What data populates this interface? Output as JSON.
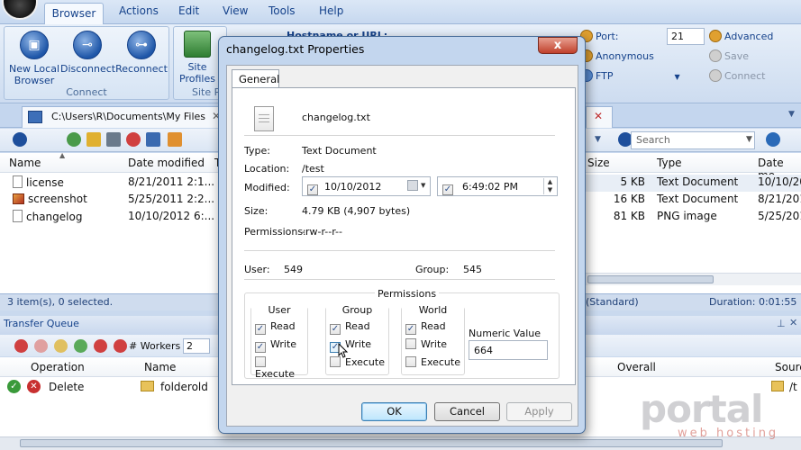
{
  "menu": {
    "items": [
      "Browser",
      "Actions",
      "Edit",
      "View",
      "Tools",
      "Help"
    ]
  },
  "ribbon": {
    "connect_group": {
      "label": "Connect",
      "buttons": [
        "New Local Browser",
        "Disconnect",
        "Reconnect"
      ]
    },
    "site_group": {
      "label": "Site P",
      "button": "Site Profiles"
    },
    "hostname_label": "Hostname or URL:",
    "port_label": "Port:",
    "port_value": "21",
    "advanced_label": "Advanced",
    "anonymous_label": "Anonymous",
    "save_label": "Save",
    "protocol_label": "FTP",
    "connect_label": "Connect"
  },
  "local_tab": {
    "path": "C:\\Users\\R\\Documents\\My Files"
  },
  "toolbar": {
    "search_placeholder": "Search"
  },
  "local_pane": {
    "columns": [
      "Name",
      "Date modified",
      "T"
    ],
    "rows": [
      {
        "name": "license",
        "date": "8/21/2011 2:1..."
      },
      {
        "name": "screenshot",
        "date": "5/25/2011 2:2..."
      },
      {
        "name": "changelog",
        "date": "10/10/2012 6:..."
      }
    ],
    "status": "3 item(s), 0 selected."
  },
  "remote_pane": {
    "columns": [
      "Size",
      "Type",
      "Date mo"
    ],
    "rows": [
      {
        "size": "5 KB",
        "type": "Text Document",
        "date": "10/10/20"
      },
      {
        "size": "16 KB",
        "type": "Text Document",
        "date": "8/21/201"
      },
      {
        "size": "81 KB",
        "type": "PNG image",
        "date": "5/25/201"
      }
    ],
    "status_mode": "(Standard)",
    "status_duration": "Duration: 0:01:55"
  },
  "transfer_queue": {
    "title": "Transfer Queue",
    "workers_label": "# Workers",
    "workers_value": "2",
    "columns": [
      "Operation",
      "Name",
      "Overall",
      "Sourc"
    ],
    "rows": [
      {
        "operation": "Delete",
        "name": "folderold",
        "source": "/t"
      }
    ]
  },
  "dialog": {
    "title": "changelog.txt Properties",
    "close_glyph": "x",
    "tab": "General",
    "file_name": "changelog.txt",
    "type_label": "Type:",
    "type_value": "Text Document",
    "location_label": "Location:",
    "location_value": "/test",
    "modified_label": "Modified:",
    "modified_date": "10/10/2012",
    "modified_time": "6:49:02 PM",
    "size_label": "Size:",
    "size_value": "4.79 KB (4,907 bytes)",
    "permissions_label": "Permissions:",
    "permissions_value": "-rw-r--r--",
    "user_label": "User:",
    "user_value": "549",
    "group_label": "Group:",
    "group_value": "545",
    "perm_box_title": "Permissions",
    "perm_columns": [
      {
        "title": "User",
        "read": true,
        "write": true,
        "execute": false
      },
      {
        "title": "Group",
        "read": true,
        "write": true,
        "execute": false
      },
      {
        "title": "World",
        "read": true,
        "write": false,
        "execute": false
      }
    ],
    "read_label": "Read",
    "write_label": "Write",
    "execute_label": "Execute",
    "numeric_label": "Numeric Value",
    "numeric_value": "664",
    "ok_label": "OK",
    "cancel_label": "Cancel",
    "apply_label": "Apply"
  },
  "watermark": {
    "main": "portal",
    "sub": "web hosting"
  }
}
